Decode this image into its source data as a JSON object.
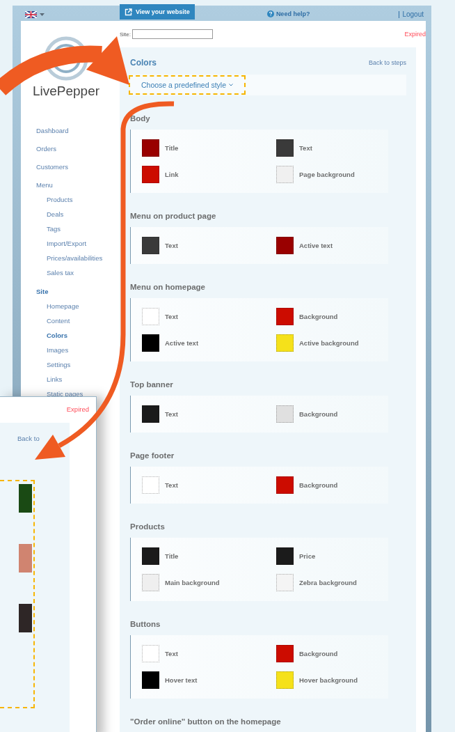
{
  "header": {
    "view_site_button": "View your website",
    "help_link": "Need help?",
    "logout_link": "Logout"
  },
  "logo": {
    "text": "LivePepper"
  },
  "sidebar": {
    "items": [
      {
        "label": "Dashboard",
        "selected": false
      },
      {
        "label": "Orders",
        "selected": false
      },
      {
        "label": "Customers",
        "selected": false
      },
      {
        "label": "Menu",
        "selected": false,
        "children": [
          {
            "label": "Products",
            "selected": false
          },
          {
            "label": "Deals",
            "selected": false
          },
          {
            "label": "Tags",
            "selected": false
          },
          {
            "label": "Import/Export",
            "selected": false
          },
          {
            "label": "Prices/availabilities",
            "selected": false
          },
          {
            "label": "Sales tax",
            "selected": false
          }
        ]
      },
      {
        "label": "Site",
        "selected": true,
        "children": [
          {
            "label": "Homepage",
            "selected": false
          },
          {
            "label": "Content",
            "selected": false
          },
          {
            "label": "Colors",
            "selected": true
          },
          {
            "label": "Images",
            "selected": false
          },
          {
            "label": "Settings",
            "selected": false
          },
          {
            "label": "Links",
            "selected": false
          },
          {
            "label": "Static pages",
            "selected": false
          }
        ]
      }
    ]
  },
  "site_field": {
    "label": "Site:"
  },
  "status": "Expired",
  "panel": {
    "title": "Colors",
    "back_link": "Back to steps",
    "style_dropdown": "Choose a predefined style",
    "sections": [
      {
        "title": "Body",
        "swatches": [
          {
            "label": "Title",
            "color": "#990000"
          },
          {
            "label": "Text",
            "color": "#3a3a3a"
          },
          {
            "label": "Link",
            "color": "#cc0c00"
          },
          {
            "label": "Page background",
            "color": "#f0f0f0"
          }
        ]
      },
      {
        "title": "Menu on product page",
        "swatches": [
          {
            "label": "Text",
            "color": "#3a3a3a"
          },
          {
            "label": "Active text",
            "color": "#990000"
          }
        ]
      },
      {
        "title": "Menu on homepage",
        "swatches": [
          {
            "label": "Text",
            "color": "#ffffff"
          },
          {
            "label": "Background",
            "color": "#cc0c00"
          },
          {
            "label": "Active text",
            "color": "#000000"
          },
          {
            "label": "Active background",
            "color": "#f5e11a"
          }
        ]
      },
      {
        "title": "Top banner",
        "swatches": [
          {
            "label": "Text",
            "color": "#1b1b1b"
          },
          {
            "label": "Background",
            "color": "#e0e0e0"
          }
        ]
      },
      {
        "title": "Page footer",
        "swatches": [
          {
            "label": "Text",
            "color": "#ffffff"
          },
          {
            "label": "Background",
            "color": "#cc0c00"
          }
        ]
      },
      {
        "title": "Products",
        "swatches": [
          {
            "label": "Title",
            "color": "#1b1b1b"
          },
          {
            "label": "Price",
            "color": "#1b1b1b"
          },
          {
            "label": "Main background",
            "color": "#efefef"
          },
          {
            "label": "Zebra background",
            "color": "#f4f4f4"
          }
        ]
      },
      {
        "title": "Buttons",
        "swatches": [
          {
            "label": "Text",
            "color": "#ffffff"
          },
          {
            "label": "Background",
            "color": "#cc0c00"
          },
          {
            "label": "Hover text",
            "color": "#000000"
          },
          {
            "label": "Hover background",
            "color": "#f5e11a"
          }
        ]
      },
      {
        "title": "\"Order online\" button on the homepage"
      }
    ]
  },
  "inset_window": {
    "status": "Expired",
    "back_link": "Back to",
    "swatches": [
      {
        "color": "#1a4a14"
      },
      {
        "color": "#d08470"
      },
      {
        "color": "#2e2626"
      }
    ]
  }
}
